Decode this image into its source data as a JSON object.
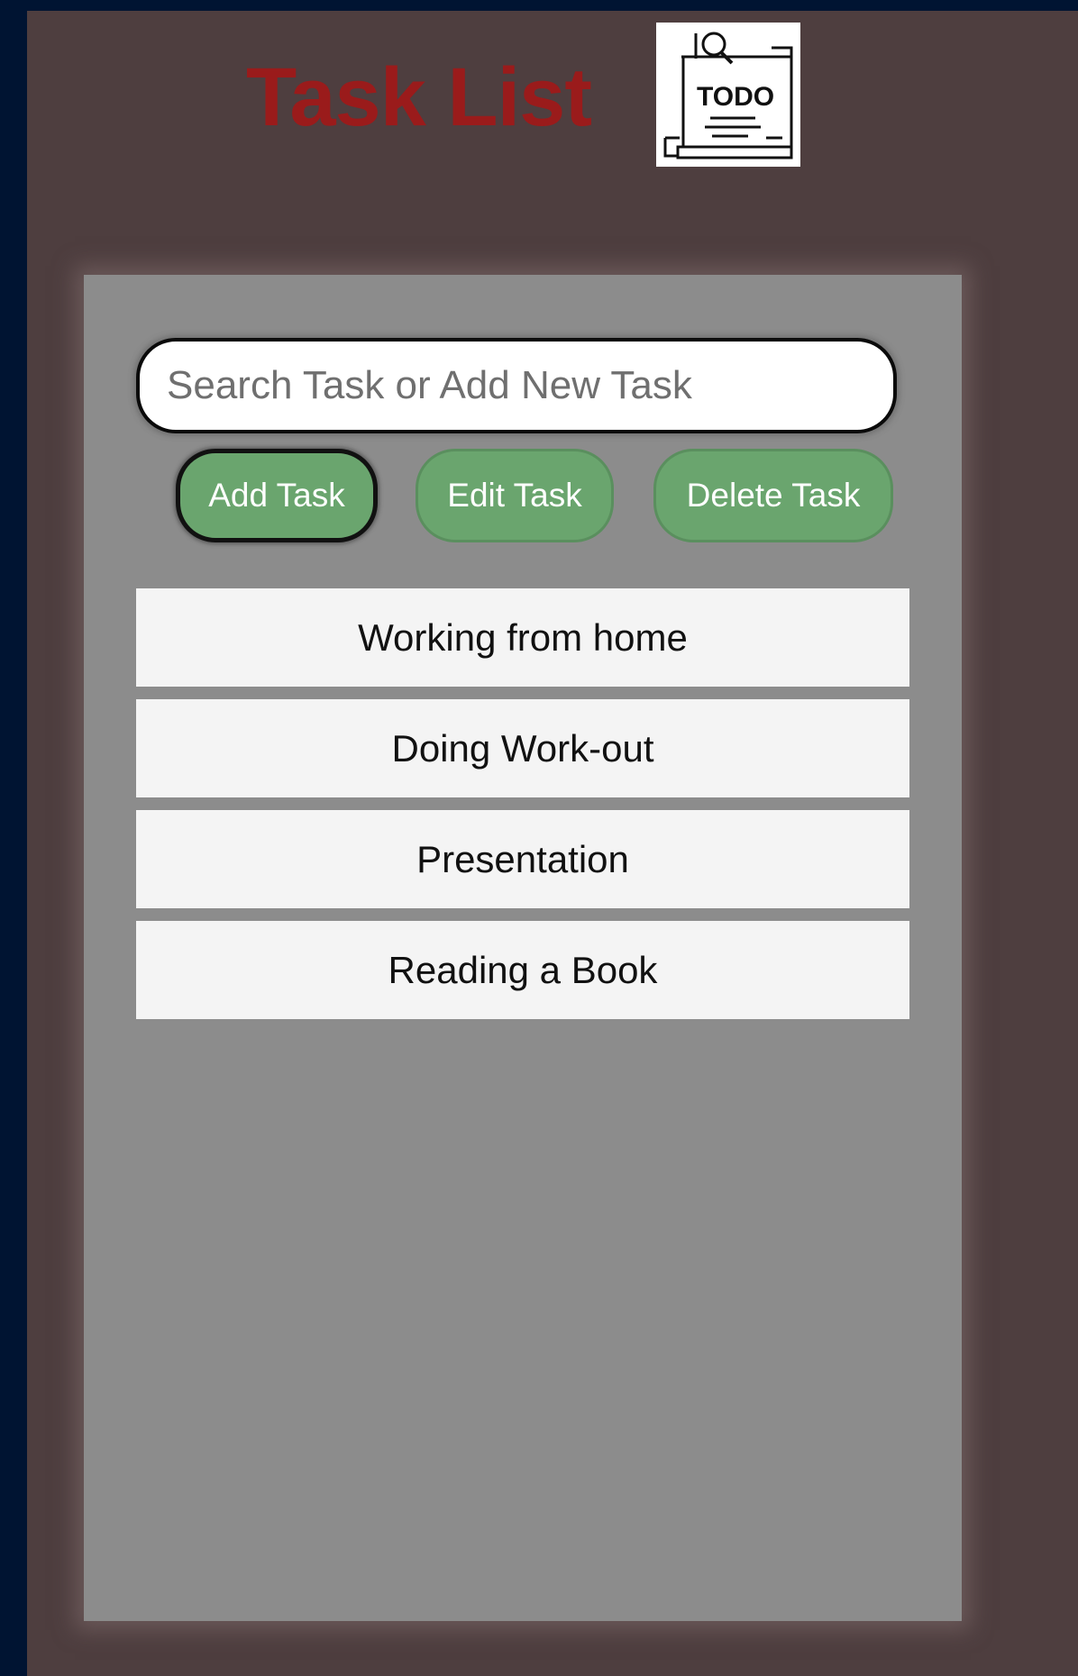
{
  "header": {
    "title": "Task List",
    "logo_icon": "todo-notepad-icon",
    "logo_text": "TODO",
    "title_color": "#9a1b1b"
  },
  "search": {
    "placeholder": "Search Task or Add New Task",
    "value": ""
  },
  "buttons": {
    "add": "Add Task",
    "edit": "Edit Task",
    "delete": "Delete Task",
    "color": "#6aa56e"
  },
  "tasks": [
    {
      "label": "Working from home"
    },
    {
      "label": "Doing Work-out"
    },
    {
      "label": "Presentation"
    },
    {
      "label": "Reading a Book"
    }
  ],
  "colors": {
    "page_background": "#001432",
    "app_background": "#4e3e3f",
    "panel_background": "#8c8c8c",
    "task_background": "#f4f4f4"
  }
}
